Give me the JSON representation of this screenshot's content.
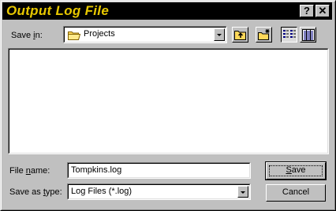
{
  "window": {
    "title": "Output Log File",
    "help_label": "?",
    "close_label": "✕"
  },
  "save_in": {
    "label_prefix": "Save ",
    "label_key": "i",
    "label_suffix": "n:",
    "value": "Projects"
  },
  "toolbar": {
    "icons": [
      "up-one-level-icon",
      "create-new-folder-icon",
      "list-view-icon",
      "details-view-icon"
    ]
  },
  "file_name": {
    "label_prefix": "File ",
    "label_key": "n",
    "label_suffix": "ame:",
    "value": "Tompkins.log"
  },
  "save_as_type": {
    "label_prefix": "Save as ",
    "label_key": "t",
    "label_suffix": "ype:",
    "value": "Log Files (*.log)"
  },
  "buttons": {
    "save_key": "S",
    "save_rest": "ave",
    "cancel": "Cancel"
  },
  "colors": {
    "title_bg": "#000000",
    "title_text": "#e8c800",
    "face": "#c0c0c0",
    "folder": "#ffd85a"
  }
}
